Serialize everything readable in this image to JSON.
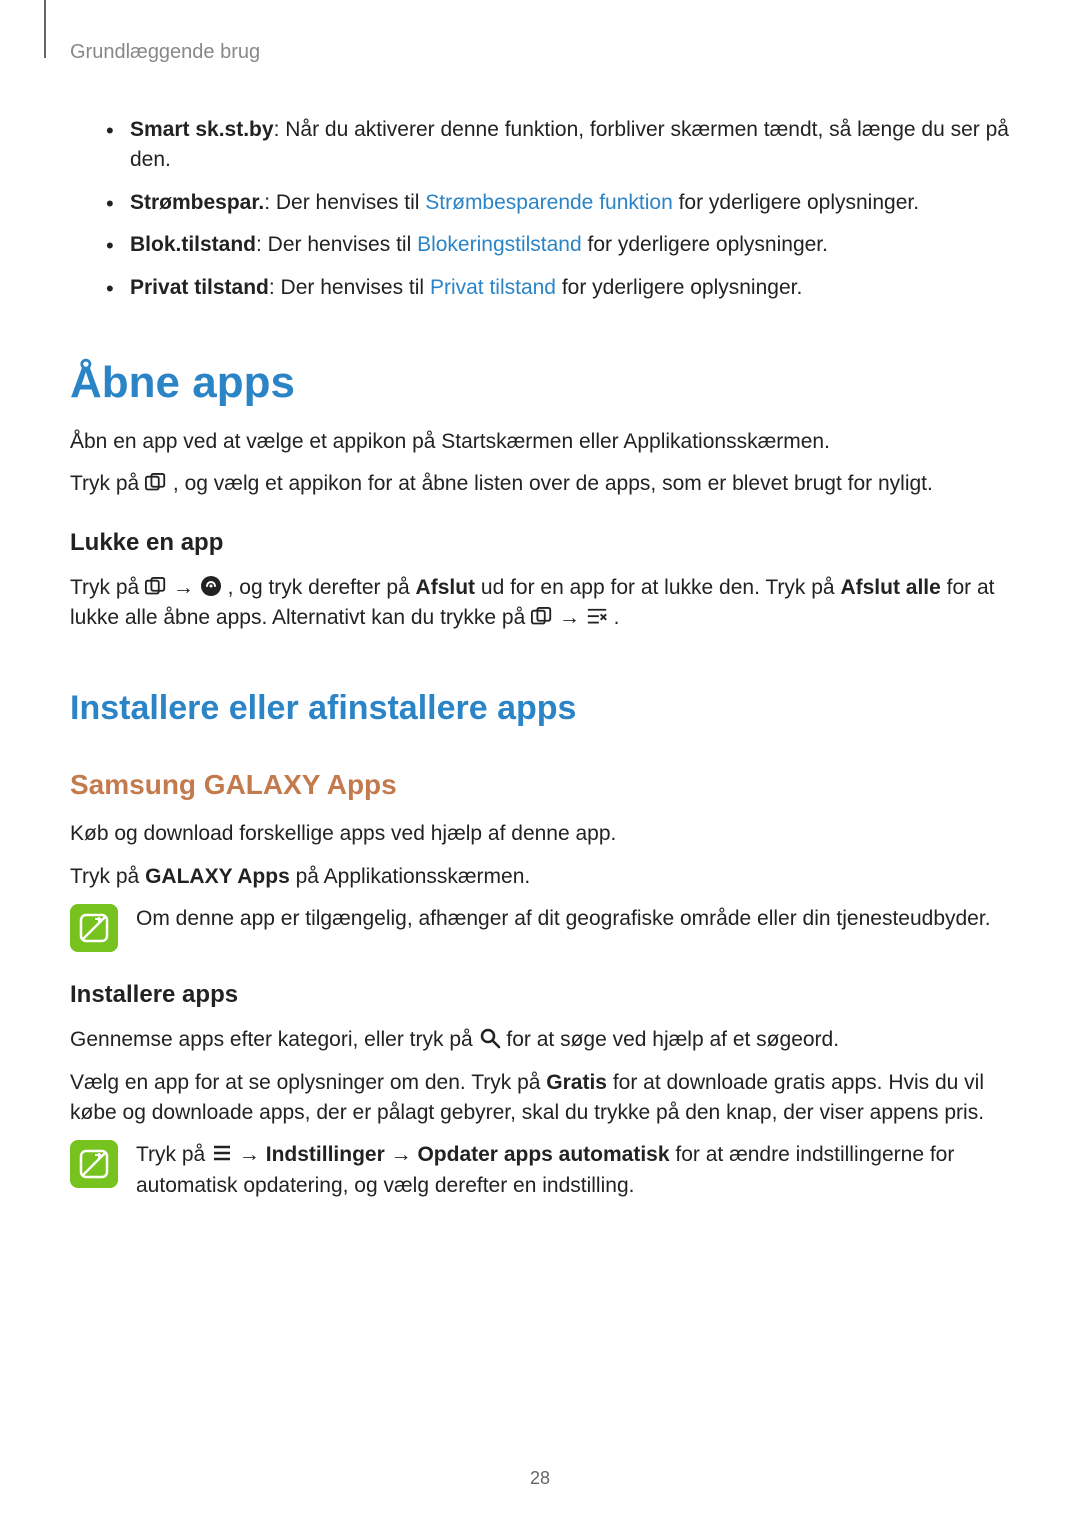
{
  "breadcrumb": "Grundlæggende brug",
  "features": [
    {
      "term": "Smart sk.st.by",
      "text": ": Når du aktiverer denne funktion, forbliver skærmen tændt, så længe du ser på den."
    },
    {
      "term": "Strømbespar.",
      "pre": ": Der henvises til ",
      "link": "Strømbesparende funktion",
      "post": " for yderligere oplysninger."
    },
    {
      "term": "Blok.tilstand",
      "pre": ": Der henvises til ",
      "link": "Blokeringstilstand",
      "post": " for yderligere oplysninger."
    },
    {
      "term": "Privat tilstand",
      "pre": ": Der henvises til ",
      "link": "Privat tilstand",
      "post": " for yderligere oplysninger."
    }
  ],
  "h1_open_apps": "Åbne apps",
  "open_apps_p1": "Åbn en app ved at vælge et appikon på Startskærmen eller Applikationsskærmen.",
  "open_apps_p2_pre": "Tryk på ",
  "open_apps_p2_post": ", og vælg et appikon for at åbne listen over de apps, som er blevet brugt for nyligt.",
  "close_app_heading": "Lukke en app",
  "close_app_p_pre": "Tryk på ",
  "close_app_arrow": " → ",
  "close_app_mid1": ", og tryk derefter på ",
  "close_app_bold1": "Afslut",
  "close_app_mid2": " ud for en app for at lukke den. Tryk på ",
  "close_app_bold2": "Afslut alle",
  "close_app_mid3": " for at lukke alle åbne apps. Alternativt kan du trykke på ",
  "close_app_end": ".",
  "h2_install": "Installere eller afinstallere apps",
  "h3_galaxy": "Samsung GALAXY Apps",
  "galaxy_p1": "Køb og download forskellige apps ved hjælp af denne app.",
  "galaxy_p2_pre": "Tryk på ",
  "galaxy_p2_bold": "GALAXY Apps",
  "galaxy_p2_post": " på Applikationsskærmen.",
  "note1": "Om denne app er tilgængelig, afhænger af dit geografiske område eller din tjenesteudbyder.",
  "install_heading": "Installere apps",
  "install_p1_pre": "Gennemse apps efter kategori, eller tryk på ",
  "install_p1_post": " for at søge ved hjælp af et søgeord.",
  "install_p2_pre": "Vælg en app for at se oplysninger om den. Tryk på ",
  "install_p2_bold": "Gratis",
  "install_p2_post": " for at downloade gratis apps. Hvis du vil købe og downloade apps, der er pålagt gebyrer, skal du trykke på den knap, der viser appens pris.",
  "note2_pre": "Tryk på ",
  "note2_arrow": " → ",
  "note2_b1": "Indstillinger",
  "note2_arrow2": " → ",
  "note2_b2": "Opdater apps automatisk",
  "note2_post": " for at ændre indstillingerne for automatisk opdatering, og vælg derefter en indstilling.",
  "page_number": "28"
}
